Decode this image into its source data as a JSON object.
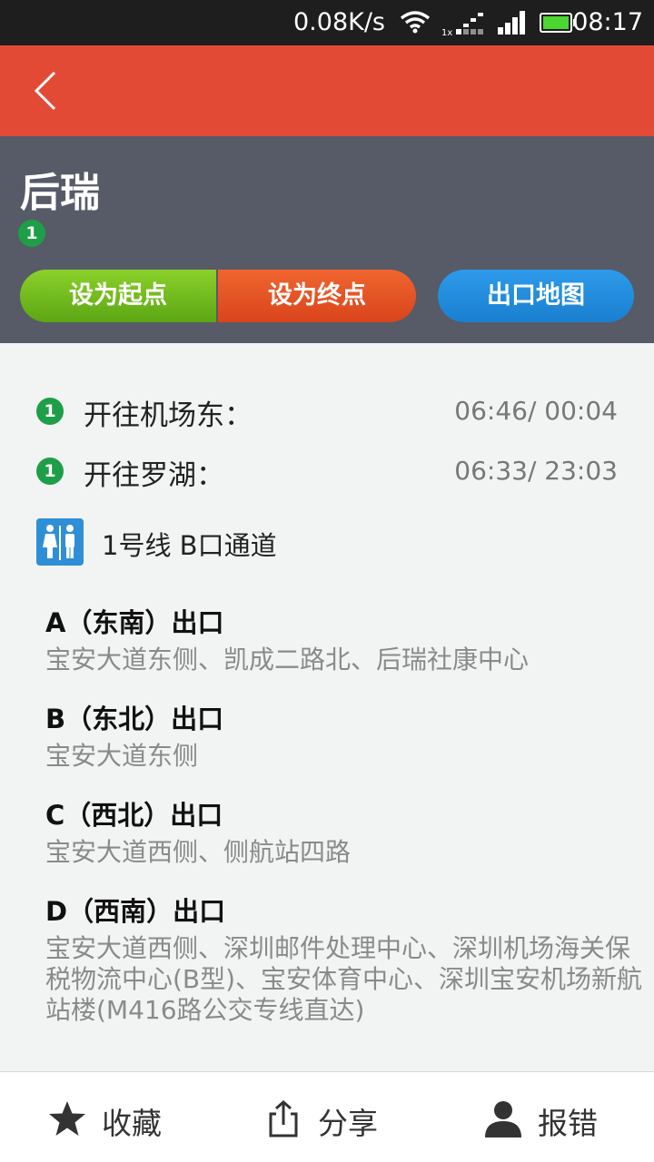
{
  "status_bar": {
    "speed": "0.08K/s",
    "time": "08:17",
    "icons": [
      "wifi-icon",
      "signal-icon",
      "signal-icon",
      "battery-icon"
    ]
  },
  "app_bar": {
    "back_icon": "chevron-left-icon",
    "color": "#e34a36"
  },
  "station": {
    "name": "后瑞",
    "line_number": "1",
    "line_color": "#1e9e47"
  },
  "actions": {
    "set_start": "设为起点",
    "set_end": "设为终点",
    "exit_map": "出口地图"
  },
  "directions": [
    {
      "line": "1",
      "label": "开往机场东：",
      "time": "06:46/ 00:04"
    },
    {
      "line": "1",
      "label": "开往罗湖：",
      "time": "06:33/ 23:03"
    }
  ],
  "facility": {
    "icon": "restroom-icon",
    "text": "1号线  B口通道"
  },
  "exits": [
    {
      "title": "A（东南）出口",
      "desc": "宝安大道东侧、凯成二路北、后瑞社康中心"
    },
    {
      "title": "B（东北）出口",
      "desc": "宝安大道东侧"
    },
    {
      "title": "C（西北）出口",
      "desc": "宝安大道西侧、侧航站四路"
    },
    {
      "title": "D（西南）出口",
      "desc": "宝安大道西侧、深圳邮件处理中心、深圳机场海关保税物流中心(B型)、宝安体育中心、深圳宝安机场新航站楼(M416路公交专线直达)"
    }
  ],
  "bottom_bar": {
    "favorite": "收藏",
    "share": "分享",
    "report": "报错"
  }
}
